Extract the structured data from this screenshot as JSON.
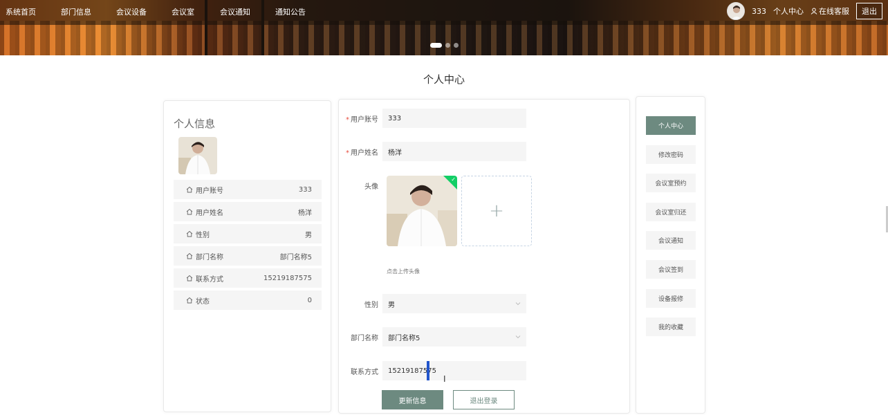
{
  "nav": {
    "items": [
      "系统首页",
      "部门信息",
      "会议设备",
      "会议室",
      "会议通知",
      "通知公告"
    ]
  },
  "user": {
    "name": "333",
    "center": "个人中心",
    "service": "在线客服",
    "logout": "退出"
  },
  "banner": {
    "slides": 3,
    "active_slide": 1
  },
  "page_title": "个人中心",
  "profile": {
    "title": "个人信息",
    "rows": [
      {
        "label": "用户账号",
        "value": "333"
      },
      {
        "label": "用户姓名",
        "value": "杨洋"
      },
      {
        "label": "性别",
        "value": "男"
      },
      {
        "label": "部门名称",
        "value": "部门名称5"
      },
      {
        "label": "联系方式",
        "value": "15219187575"
      },
      {
        "label": "状态",
        "value": "0"
      }
    ]
  },
  "form": {
    "account": {
      "label": "用户账号",
      "value": "333",
      "required": true
    },
    "name": {
      "label": "用户姓名",
      "value": "杨洋",
      "required": true
    },
    "avatar": {
      "label": "头像",
      "hint": "点击上传头像",
      "add": "+"
    },
    "gender": {
      "label": "性别",
      "value": "男"
    },
    "dept": {
      "label": "部门名称",
      "value": "部门名称5"
    },
    "phone": {
      "label": "联系方式",
      "value": "15219187575"
    },
    "update_btn": "更新信息",
    "logout_btn": "退出登录"
  },
  "side_menu": {
    "items": [
      "个人中心",
      "修改密码",
      "会议室预约",
      "会议室归还",
      "会议通知",
      "会议签到",
      "设备报修",
      "我的收藏"
    ],
    "active": 0
  },
  "colors": {
    "accent": "#6d8a80",
    "required": "#e84c3d",
    "upload_ok": "#13ce66"
  }
}
